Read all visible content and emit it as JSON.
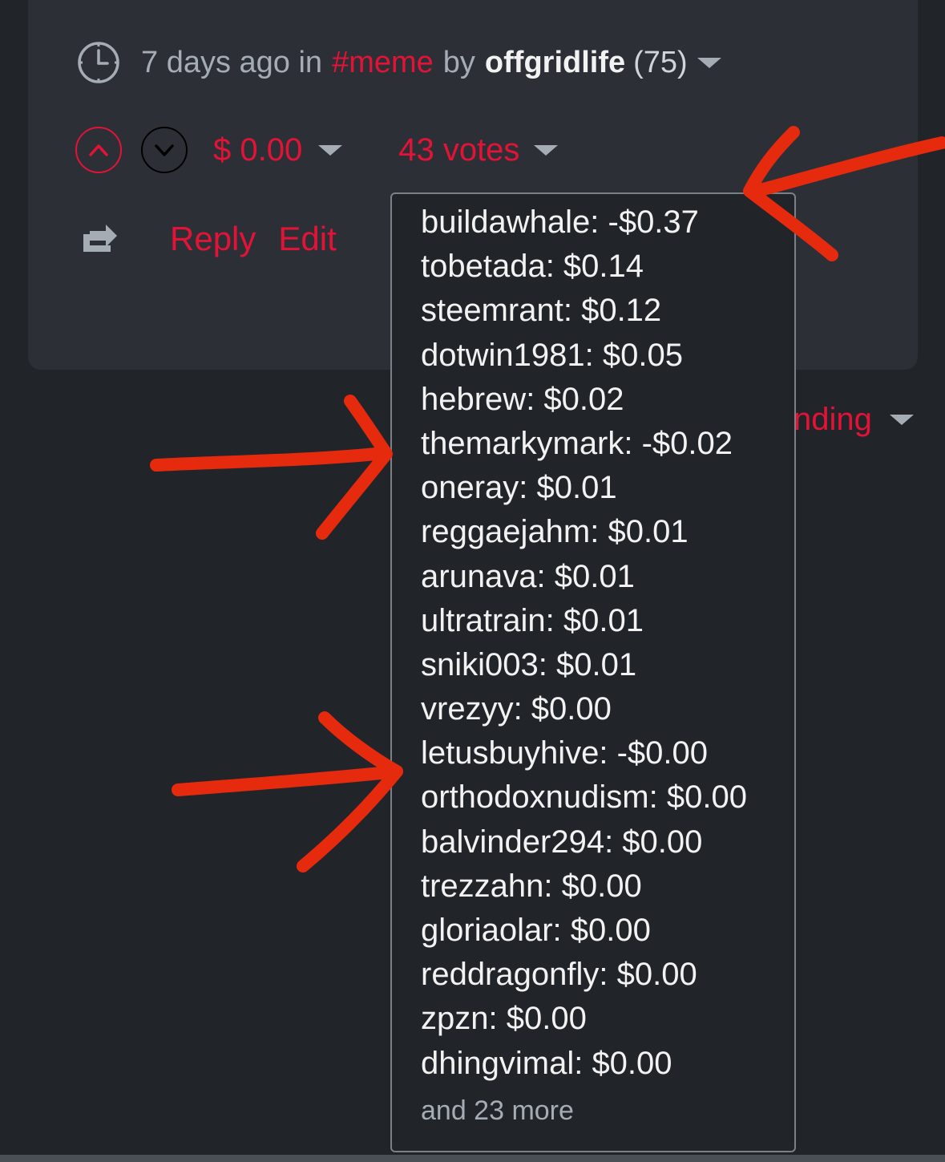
{
  "post_meta": {
    "time_ago": "7 days ago in",
    "tag": "#meme",
    "by": "by",
    "author": "offgridlife",
    "reputation": "(75)"
  },
  "voting": {
    "payout": "$ 0.00",
    "votes_label": "43 votes"
  },
  "actions": {
    "reply": "Reply",
    "edit": "Edit"
  },
  "sort": {
    "label_partial": "nding"
  },
  "voters_dropdown": {
    "items": [
      "buildawhale: -$0.37",
      "tobetada: $0.14",
      "steemrant: $0.12",
      "dotwin1981: $0.05",
      "hebrew: $0.02",
      "themarkymark: -$0.02",
      "oneray: $0.01",
      "reggaejahm: $0.01",
      "arunava: $0.01",
      "ultratrain: $0.01",
      "sniki003: $0.01",
      "vrezyy: $0.00",
      "letusbuyhive: -$0.00",
      "orthodoxnudism: $0.00",
      "balvinder294: $0.00",
      "trezzahn: $0.00",
      "gloriaolar: $0.00",
      "reddragonfly: $0.00",
      "zpzn: $0.00",
      "dhingvimal: $0.00"
    ],
    "more": "and 23 more"
  },
  "icons": {
    "time": "clock-icon",
    "upvote": "chevron-up-icon",
    "downvote": "chevron-down-icon",
    "share": "reblog-icon",
    "dropdown": "caret-down-icon"
  },
  "colors": {
    "accent": "#e31337",
    "background": "#212429",
    "card": "#2c3036",
    "annotation": "#e52a0e"
  }
}
